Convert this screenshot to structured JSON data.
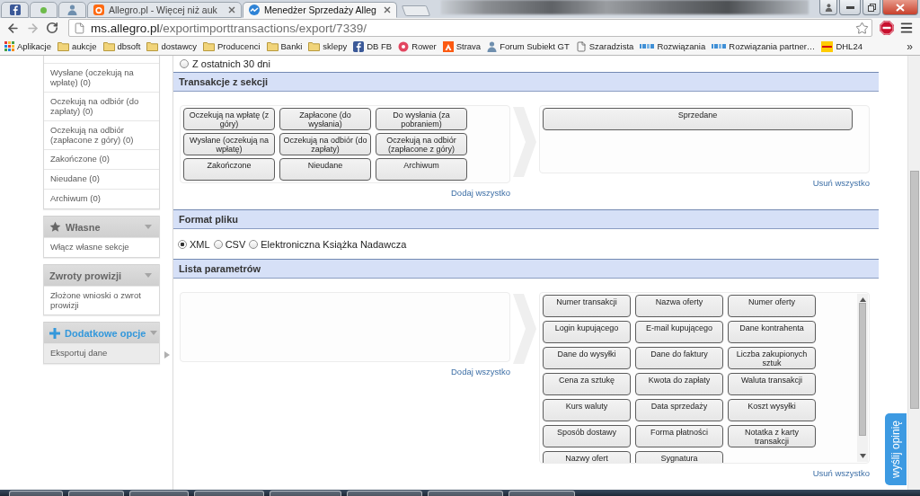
{
  "browser": {
    "tabs": [
      {
        "selected": false
      },
      {
        "selected": false
      },
      {
        "selected": false
      },
      {
        "title": "Allegro.pl - Więcej niż auk",
        "selected": false
      },
      {
        "title": "Menedżer Sprzedaży Alleg",
        "selected": true
      }
    ],
    "address": {
      "host": "ms.allegro.pl",
      "path": "/exportimporttransactions/export/7339/"
    },
    "bookmarks": [
      {
        "label": "Aplikacje",
        "kind": "apps"
      },
      {
        "label": "aukcje",
        "kind": "folder"
      },
      {
        "label": "dbsoft",
        "kind": "folder"
      },
      {
        "label": "dostawcy",
        "kind": "folder"
      },
      {
        "label": "Producenci",
        "kind": "folder"
      },
      {
        "label": "Banki",
        "kind": "folder"
      },
      {
        "label": "sklepy",
        "kind": "folder"
      },
      {
        "label": "DB FB",
        "kind": "site"
      },
      {
        "label": "Rower",
        "kind": "site"
      },
      {
        "label": "Strava",
        "kind": "site"
      },
      {
        "label": "Forum Subiekt GT",
        "kind": "site"
      },
      {
        "label": "Szaradzista",
        "kind": "page"
      },
      {
        "label": "Rozwiązania",
        "kind": "site"
      },
      {
        "label": "Rozwiązania partner…",
        "kind": "site"
      },
      {
        "label": "DHL24",
        "kind": "site"
      }
    ],
    "bookmarks_overflow": "»"
  },
  "sidebar": {
    "panels": [
      {
        "items": [
          {
            "label": "Wysłane (oczekują na wpłatę) (0)",
            "selected": false
          },
          {
            "label": "Oczekują na odbiór (do zapłaty) (0)",
            "selected": false
          },
          {
            "label": "Oczekują na odbiór (zapłacone z góry) (0)",
            "selected": false
          },
          {
            "label": "Zakończone (0)",
            "selected": false
          },
          {
            "label": "Nieudane (0)",
            "selected": false
          },
          {
            "label": "Archiwum (0)",
            "selected": false
          }
        ]
      },
      {
        "title": "Własne",
        "active": false,
        "items": [
          {
            "label": "Włącz własne sekcje",
            "selected": false
          }
        ]
      },
      {
        "title": "Zwroty prowizji",
        "active": false,
        "items": [
          {
            "label": "Złożone wnioski o zwrot prowizji",
            "selected": false
          }
        ]
      },
      {
        "title": "Dodatkowe opcje",
        "active": true,
        "items": [
          {
            "label": "Eksportuj dane",
            "selected": true
          }
        ]
      }
    ]
  },
  "main": {
    "period_option": {
      "label": "Z ostatnich 30 dni",
      "selected": false
    },
    "sections": [
      {
        "title": "Transakcje z sekcji",
        "kind": "listpicker",
        "available": [
          {
            "label": "Oczekują na wpłatę (z góry)"
          },
          {
            "label": "Zapłacone (do wysłania)"
          },
          {
            "label": "Do wysłania (za pobraniem)"
          },
          {
            "label": "Wysłane (oczekują na wpłatę)"
          },
          {
            "label": "Oczekują na odbiór (do zapłaty)"
          },
          {
            "label": "Oczekują na odbiór (zapłacone z góry)"
          },
          {
            "label": "Zakończone"
          },
          {
            "label": "Nieudane"
          },
          {
            "label": "Archiwum"
          }
        ],
        "add_all": "Dodaj wszystko",
        "chosen": [
          {
            "label": "Sprzedane"
          }
        ],
        "remove_all": "Usuń wszystko"
      },
      {
        "title": "Format pliku",
        "kind": "radios",
        "options": [
          {
            "label": "XML",
            "selected": true
          },
          {
            "label": "CSV",
            "selected": false
          },
          {
            "label": "Elektroniczna Książka Nadawcza",
            "selected": false
          }
        ]
      },
      {
        "title": "Lista parametrów",
        "kind": "gridpicker",
        "add_all": "Dodaj wszystko",
        "chosen": [
          {
            "label": "Numer transakcji"
          },
          {
            "label": "Nazwa oferty"
          },
          {
            "label": "Numer oferty"
          },
          {
            "label": "Login kupującego"
          },
          {
            "label": "E-mail kupującego"
          },
          {
            "label": "Dane kontrahenta"
          },
          {
            "label": "Dane do wysyłki"
          },
          {
            "label": "Dane do faktury"
          },
          {
            "label": "Liczba zakupionych sztuk"
          },
          {
            "label": "Cena za sztukę"
          },
          {
            "label": "Kwota do zapłaty"
          },
          {
            "label": "Waluta transakcji"
          },
          {
            "label": "Kurs waluty"
          },
          {
            "label": "Data sprzedaży"
          },
          {
            "label": "Koszt wysyłki"
          },
          {
            "label": "Sposób dostawy"
          },
          {
            "label": "Forma płatności"
          },
          {
            "label": "Notatka z karty transakcji"
          },
          {
            "label": "Nazwy ofert"
          },
          {
            "label": "Sygnatura"
          }
        ],
        "remove_all": "Usuń wszystko"
      }
    ]
  },
  "feedback_tab": "wyślij opinię"
}
